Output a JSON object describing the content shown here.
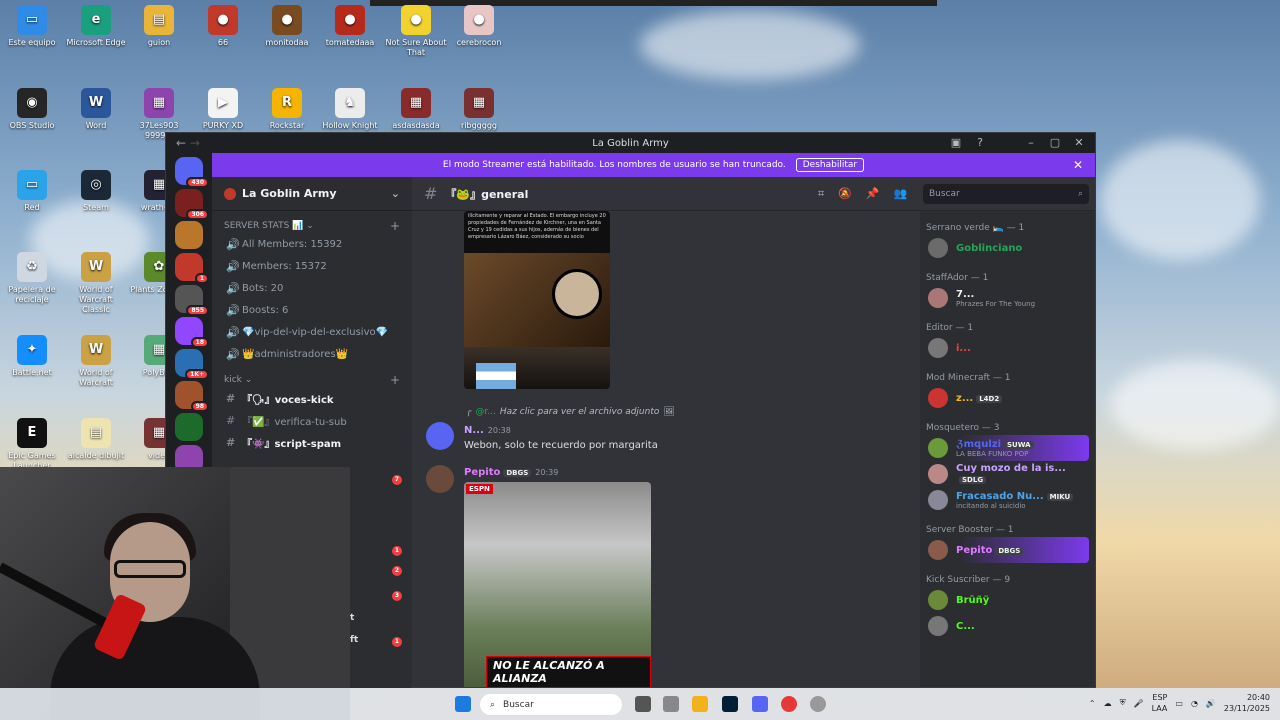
{
  "desktop_icons": [
    {
      "label": "Este equipo",
      "color": "#2f8be6",
      "glyph": "▭"
    },
    {
      "label": "Microsoft Edge",
      "color": "#1a9f7f",
      "glyph": "e"
    },
    {
      "label": "guion",
      "color": "#e9b43a",
      "glyph": "▤"
    },
    {
      "label": "66",
      "color": "#c0392b",
      "glyph": "●"
    },
    {
      "label": "monitodaa",
      "color": "#7a4a21",
      "glyph": "●"
    },
    {
      "label": "tomatedaaa",
      "color": "#b62a1c",
      "glyph": "●"
    },
    {
      "label": "Not Sure About That",
      "color": "#f2d22e",
      "glyph": "●"
    },
    {
      "label": "cerebrocon",
      "color": "#e8c6c6",
      "glyph": "●"
    },
    {
      "label": "OBS Studio",
      "color": "#262626",
      "glyph": "◉"
    },
    {
      "label": "Word",
      "color": "#2b579a",
      "glyph": "W"
    },
    {
      "label": "37Les903 9999...",
      "color": "#8e44ad",
      "glyph": "▦"
    },
    {
      "label": "PURKY XD",
      "color": "#f3f3f3",
      "glyph": "▶"
    },
    {
      "label": "Rockstar Games",
      "color": "#f4b400",
      "glyph": "R"
    },
    {
      "label": "Hollow Knight",
      "color": "#ececec",
      "glyph": "♞"
    },
    {
      "label": "asdasdasda",
      "color": "#8a2b2b",
      "glyph": "▦"
    },
    {
      "label": "ribggggg",
      "color": "#7a3030",
      "glyph": "▦"
    },
    {
      "label": "Red",
      "color": "#2aa3e8",
      "glyph": "▭"
    },
    {
      "label": "Steam",
      "color": "#1b2838",
      "glyph": "◎"
    },
    {
      "label": "wrath-of-",
      "color": "#223",
      "glyph": "▦"
    },
    {
      "label": "Papelera de reciclaje",
      "color": "#cfd8e2",
      "glyph": "♻"
    },
    {
      "label": "World of Warcraft Classic",
      "color": "#caa144",
      "glyph": "W"
    },
    {
      "label": "Plants Zombie",
      "color": "#5c8a2a",
      "glyph": "✿"
    },
    {
      "label": "Battle.net",
      "color": "#148eff",
      "glyph": "✦"
    },
    {
      "label": "World of Warcraft",
      "color": "#caa144",
      "glyph": "W"
    },
    {
      "label": "PolyBrid",
      "color": "#5a7",
      "glyph": "▦"
    },
    {
      "label": "Epic Games Launcher",
      "color": "#111111",
      "glyph": "E"
    },
    {
      "label": "alcalde dibujit",
      "color": "#eee4b0",
      "glyph": "▤"
    },
    {
      "label": "video",
      "color": "#733",
      "glyph": "▦"
    }
  ],
  "window": {
    "title": "La Goblin Army",
    "back": "←",
    "forward": "→"
  },
  "banner": {
    "text": "El modo Streamer está habilitado. Los nombres de usuario se han truncado.",
    "button": "Deshabilitar",
    "close": "✕"
  },
  "guilds": [
    {
      "color": "#5865f2",
      "badge": "430"
    },
    {
      "color": "#7a2020",
      "badge": "306"
    },
    {
      "color": "#b8772a",
      "badge": ""
    },
    {
      "color": "#c0392b",
      "badge": "1"
    },
    {
      "color": "#555",
      "badge": "855"
    },
    {
      "color": "#9146ff",
      "badge": "18"
    },
    {
      "color": "#2a6fb2",
      "badge": "1K+"
    },
    {
      "color": "#a0522d",
      "badge": "98"
    },
    {
      "color": "#1d6b2a",
      "badge": ""
    },
    {
      "color": "#8e44ad",
      "badge": ""
    }
  ],
  "server": {
    "name": "La Goblin Army",
    "categories": [
      {
        "name": "SERVER STATS 📊",
        "channels": [
          {
            "icon": "🔊",
            "name": "All Members: 15392",
            "bold": false
          },
          {
            "icon": "🔊",
            "name": "Members: 15372",
            "bold": false
          },
          {
            "icon": "🔊",
            "name": "Bots: 20",
            "bold": false
          },
          {
            "icon": "🔊",
            "name": "Boosts: 6",
            "bold": false
          },
          {
            "icon": "🔊",
            "name": "💎vip-del-vip-del-exclusivo💎",
            "bold": false
          },
          {
            "icon": "🔊",
            "name": "👑administradores👑",
            "bold": false
          }
        ]
      },
      {
        "name": "kick",
        "channels": [
          {
            "icon": "#",
            "name": "『🗣』voces-kick",
            "bold": true
          },
          {
            "icon": "#",
            "name": "『✅』verifica-tu-sub",
            "bold": false
          },
          {
            "icon": "#",
            "name": "『👾』script-spam",
            "bold": true
          }
        ]
      }
    ]
  },
  "strip": {
    "badges": [
      "7",
      "1",
      "2",
      "3",
      "1"
    ],
    "texts": [
      "t",
      "ft"
    ]
  },
  "channel": {
    "name": "『🐸』general",
    "search_placeholder": "Buscar"
  },
  "messages": {
    "image1_text": "ilícitamente y reparar al Estado. El embargo incluye 20 propiedades de Fernández de Kirchner, una en Santa Cruz y 19 cedidas a sus hijos, además de bienes del empresario Lázaro Báez, considerado su socio",
    "reply_author": "@r...",
    "reply_text": "Haz clic para ver el archivo adjunto",
    "msg1_author": "N...",
    "msg1_time": "20:38",
    "msg1_text": "Webon, solo te recuerdo por margarita",
    "msg2_author": "Pepito",
    "msg2_tag": "DBGS",
    "msg2_time": "20:39",
    "image2_brand": "ESPN",
    "image2_caption": "NO LE ALCANZÓ A ALIANZA"
  },
  "members": [
    {
      "role": "Serrano verde 🛌 — 1",
      "people": [
        {
          "name": "Goblinciano",
          "color": "#23a55a",
          "sub": "",
          "tag": "",
          "boost": false,
          "avatar": "#6b6b6b"
        }
      ]
    },
    {
      "role": "StaffAdor — 1",
      "people": [
        {
          "name": "7...",
          "color": "#f2f3f5",
          "sub": "Phrazes For The Young",
          "tag": "",
          "boost": false,
          "avatar": "#aa7777"
        }
      ]
    },
    {
      "role": "Editor — 1",
      "people": [
        {
          "name": "i...",
          "color": "#f23f42",
          "sub": "",
          "tag": "",
          "boost": false,
          "avatar": "#777"
        }
      ]
    },
    {
      "role": "Mod Minecraft — 1",
      "people": [
        {
          "name": "z...",
          "color": "#f0b232",
          "sub": "",
          "tag": "L4D2",
          "boost": false,
          "avatar": "#c33"
        }
      ]
    },
    {
      "role": "Mosquetero — 3",
      "people": [
        {
          "name": "ℨmqulzi",
          "color": "#5865f2",
          "sub": "LA BEBA FUNKO POP",
          "tag": "SUWA",
          "boost": true,
          "avatar": "#6a9a3a"
        },
        {
          "name": "Cuy mozo de la is...",
          "color": "#c8a2ff",
          "sub": "",
          "tag": "SDLG",
          "boost": false,
          "avatar": "#b88"
        },
        {
          "name": "Fracasado Nu...",
          "color": "#4ea3e8",
          "sub": "incitando al suicidio",
          "tag": "MIKU",
          "boost": false,
          "avatar": "#889"
        }
      ]
    },
    {
      "role": "Server Booster — 1",
      "people": [
        {
          "name": "Pepito",
          "color": "#e07bff",
          "sub": "",
          "tag": "DBGS",
          "boost": true,
          "avatar": "#8a5a4a"
        }
      ]
    },
    {
      "role": "Kick Suscriber — 9",
      "people": [
        {
          "name": "Brūñÿ",
          "color": "#53fc18",
          "sub": "",
          "tag": "",
          "boost": false,
          "avatar": "#6a8a3a"
        },
        {
          "name": "C...",
          "color": "#53fc18",
          "sub": "",
          "tag": "",
          "boost": false,
          "avatar": "#777"
        }
      ]
    }
  ],
  "taskbar": {
    "search": "Buscar",
    "lang1": "ESP",
    "lang2": "LAA",
    "time": "20:40",
    "date": "23/11/2025"
  }
}
